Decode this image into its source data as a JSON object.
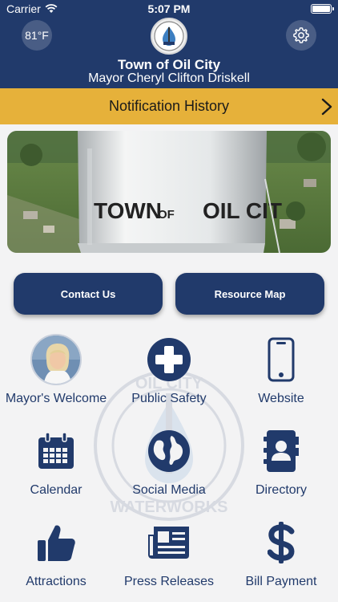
{
  "status_bar": {
    "carrier": "Carrier",
    "time": "5:07 PM"
  },
  "header": {
    "temperature": "81°F",
    "title": "Town of Oil City",
    "subtitle": "Mayor Cheryl Clifton Driskell",
    "logo_text": "WATERWORKS"
  },
  "notification": {
    "label": "Notification History"
  },
  "hero": {
    "tower_text_1": "TOWN",
    "tower_text_2": "OF",
    "tower_text_3": "OIL CIT"
  },
  "buttons": {
    "contact": "Contact Us",
    "map": "Resource Map"
  },
  "grid": [
    {
      "label": "Mayor's Welcome",
      "icon": "avatar"
    },
    {
      "label": "Public Safety",
      "icon": "plus-circle-icon"
    },
    {
      "label": "Website",
      "icon": "phone-icon"
    },
    {
      "label": "Calendar",
      "icon": "calendar-icon"
    },
    {
      "label": "Social Media",
      "icon": "globe-icon"
    },
    {
      "label": "Directory",
      "icon": "address-book-icon"
    },
    {
      "label": "Attractions",
      "icon": "thumbs-up-icon"
    },
    {
      "label": "Press Releases",
      "icon": "newspaper-icon"
    },
    {
      "label": "Bill Payment",
      "icon": "dollar-icon"
    }
  ],
  "watermark": {
    "top_text": "OIL CITY",
    "bottom_text": "WATERWORKS"
  },
  "colors": {
    "primary": "#213a6b",
    "accent": "#e6b13a",
    "background": "#f3f3f4"
  }
}
